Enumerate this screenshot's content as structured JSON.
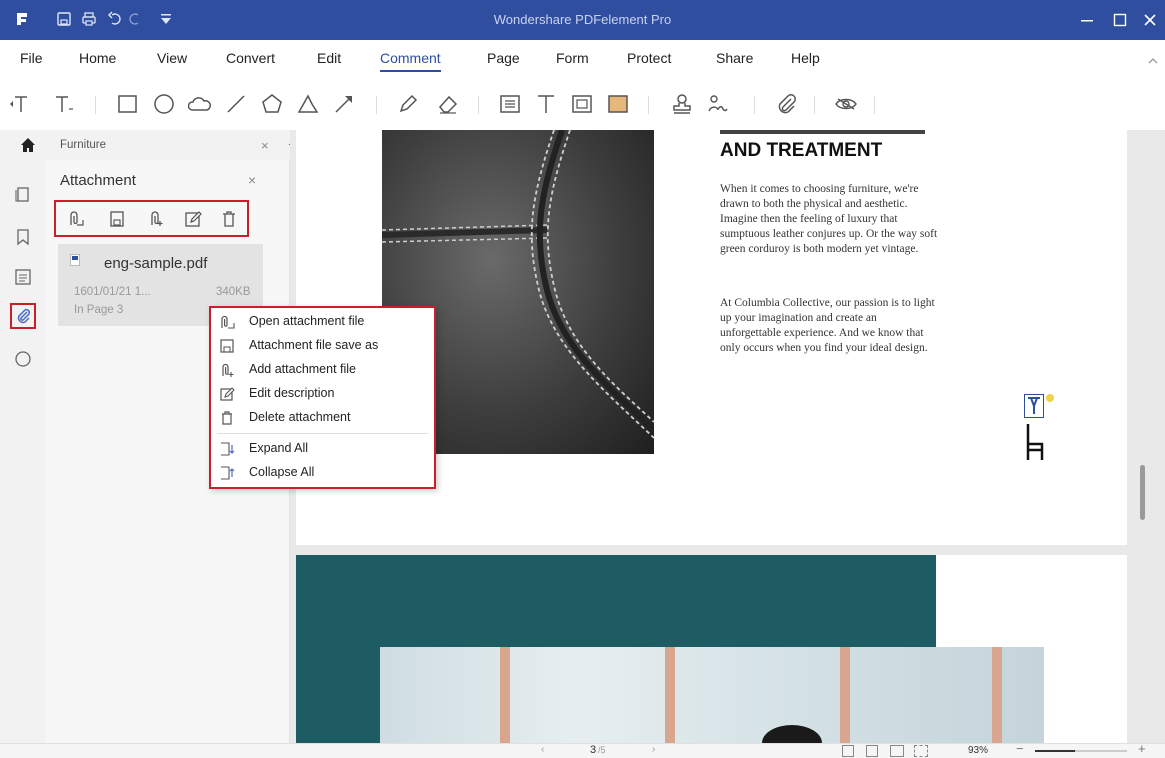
{
  "window": {
    "title": "Wondershare PDFelement Pro",
    "controls": [
      "minimize",
      "maximize",
      "close"
    ]
  },
  "menu": {
    "items": [
      "File",
      "Home",
      "View",
      "Convert",
      "Edit",
      "Comment",
      "Page",
      "Form",
      "Protect",
      "Share",
      "Help"
    ],
    "active": "Comment"
  },
  "document_tab": {
    "label": "Furniture",
    "close_glyph": "×",
    "add_glyph": "+"
  },
  "attachment_panel": {
    "title": "Attachment",
    "close_glyph": "×",
    "file": {
      "name": "eng-sample.pdf",
      "date": "1601/01/21 1...",
      "size": "340KB",
      "location": "In Page 3"
    }
  },
  "context_menu": {
    "items": [
      {
        "label": "Open attachment file",
        "icon": "open-attachment-icon"
      },
      {
        "label": "Attachment file save as",
        "icon": "save-icon"
      },
      {
        "label": "Add attachment file",
        "icon": "add-attachment-icon"
      },
      {
        "label": "Edit description",
        "icon": "edit-icon"
      },
      {
        "label": "Delete attachment",
        "icon": "trash-icon"
      },
      {
        "label": "Expand All",
        "icon": "expand-icon"
      },
      {
        "label": "Collapse All",
        "icon": "collapse-icon"
      }
    ]
  },
  "document": {
    "heading": "AND TREATMENT",
    "paragraph1": "When it comes to choosing furniture, we're drawn to both the physical and aesthetic. Imagine then the feeling of luxury that sumptuous leather conjures up. Or the way soft green corduroy is both modern yet vintage.",
    "paragraph2": "At Columbia Collective, our passion is to light up your imagination and create an unforgettable experience. And we know that only occurs when you find your ideal design."
  },
  "statusbar": {
    "page_current": "3",
    "page_total": "/5",
    "zoom": "93%"
  },
  "colors": {
    "titlebar": "#2f4ea0",
    "accent": "#2f4ea0",
    "highlight_box": "#c8202a",
    "teal_block": "#1e5c63"
  }
}
